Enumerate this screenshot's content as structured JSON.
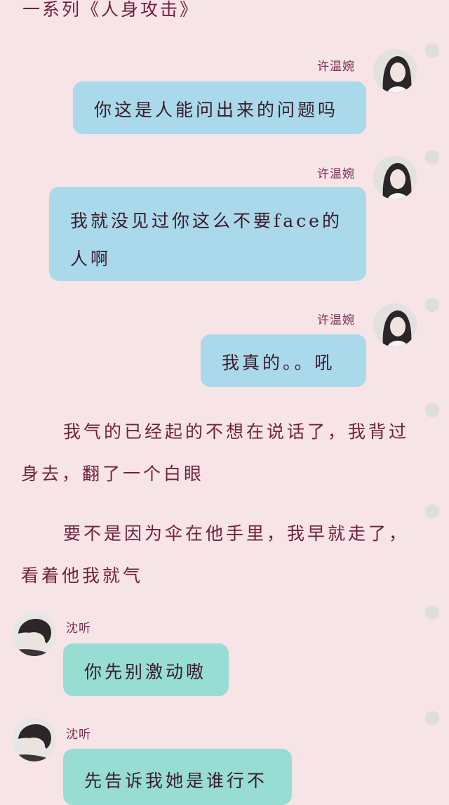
{
  "header": {
    "title": "一系列《人身攻击》"
  },
  "messages": [
    {
      "sender": "许温婉",
      "text": "你这是人能问出来的问题吗"
    },
    {
      "sender": "许温婉",
      "text": "我就没见过你这么不要face的人啊"
    },
    {
      "sender": "许温婉",
      "text": "我真的。。吼"
    },
    {
      "sender": "沈听",
      "text": "你先别激动嗷"
    },
    {
      "sender": "沈听",
      "text": "先告诉我她是谁行不"
    }
  ],
  "narration": [
    "我气的已经起的不想在说话了，我背过身去，翻了一个白眼",
    "要不是因为伞在他手里，我早就走了，看着他我就气"
  ],
  "colors": {
    "background": "#f7e4e7",
    "bubble_right": "#a9d9ea",
    "bubble_left": "#97ddd3",
    "text_dark_red": "#6f1f3d"
  }
}
